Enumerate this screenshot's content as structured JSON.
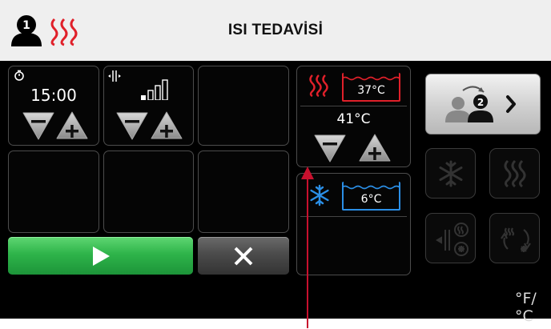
{
  "header": {
    "title": "ISI TEDAVİSİ",
    "patient_number": "1",
    "heat_color": "#e0202a"
  },
  "left_panel": {
    "timer": {
      "icon": "timer-icon",
      "value": "15:00"
    },
    "intensity": {
      "icon": "vibration-icon",
      "level_icon": "signal-bars-icon"
    }
  },
  "buttons": {
    "start": {
      "icon": "play-icon"
    },
    "cancel": {
      "icon": "close-icon"
    }
  },
  "therapy": {
    "heat_tank": {
      "label": "37°C",
      "color": "#e0202a"
    },
    "heat_setpoint": "41°C",
    "cold_tank": {
      "label": "6°C",
      "color": "#2b8fe6"
    }
  },
  "right_panel": {
    "swap_patient_number": "2",
    "unit_toggle": "°F/°C"
  }
}
